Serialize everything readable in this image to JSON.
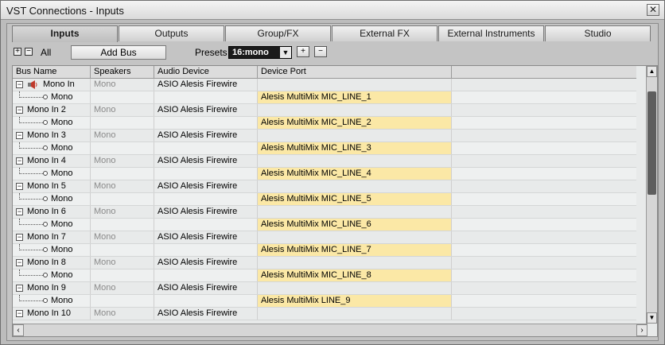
{
  "window": {
    "title": "VST Connections - Inputs",
    "close_glyph": "✕"
  },
  "tabs": [
    {
      "label": "Inputs",
      "active": true
    },
    {
      "label": "Outputs",
      "active": false
    },
    {
      "label": "Group/FX",
      "active": false
    },
    {
      "label": "External FX",
      "active": false
    },
    {
      "label": "External Instruments",
      "active": false
    },
    {
      "label": "Studio",
      "active": false
    }
  ],
  "toolbar": {
    "all_label": "All",
    "add_bus_label": "Add Bus",
    "presets_label": "Presets",
    "preset_value": "16:mono"
  },
  "columns": [
    "Bus Name",
    "Speakers",
    "Audio Device",
    "Device Port"
  ],
  "rows": [
    {
      "bus": "Mono In",
      "speakers": "Mono",
      "device": "ASIO Alesis Firewire",
      "child": "Mono",
      "port": "Alesis MultiMix MIC_LINE_1",
      "icon": true
    },
    {
      "bus": "Mono In 2",
      "speakers": "Mono",
      "device": "ASIO Alesis Firewire",
      "child": "Mono",
      "port": "Alesis MultiMix MIC_LINE_2"
    },
    {
      "bus": "Mono In 3",
      "speakers": "Mono",
      "device": "ASIO Alesis Firewire",
      "child": "Mono",
      "port": "Alesis MultiMix MIC_LINE_3"
    },
    {
      "bus": "Mono In 4",
      "speakers": "Mono",
      "device": "ASIO Alesis Firewire",
      "child": "Mono",
      "port": "Alesis MultiMix MIC_LINE_4"
    },
    {
      "bus": "Mono In 5",
      "speakers": "Mono",
      "device": "ASIO Alesis Firewire",
      "child": "Mono",
      "port": "Alesis MultiMix MIC_LINE_5"
    },
    {
      "bus": "Mono In 6",
      "speakers": "Mono",
      "device": "ASIO Alesis Firewire",
      "child": "Mono",
      "port": "Alesis MultiMix MIC_LINE_6"
    },
    {
      "bus": "Mono In 7",
      "speakers": "Mono",
      "device": "ASIO Alesis Firewire",
      "child": "Mono",
      "port": "Alesis MultiMix MIC_LINE_7"
    },
    {
      "bus": "Mono In 8",
      "speakers": "Mono",
      "device": "ASIO Alesis Firewire",
      "child": "Mono",
      "port": "Alesis MultiMix MIC_LINE_8"
    },
    {
      "bus": "Mono In 9",
      "speakers": "Mono",
      "device": "ASIO Alesis Firewire",
      "child": "Mono",
      "port": "Alesis MultiMix LINE_9"
    },
    {
      "bus": "Mono In 10",
      "speakers": "Mono",
      "device": "ASIO Alesis Firewire",
      "child": "",
      "port": ""
    }
  ],
  "colors": {
    "port_highlight": "#fbe8a6",
    "preset_bg": "#1b1b1b"
  }
}
